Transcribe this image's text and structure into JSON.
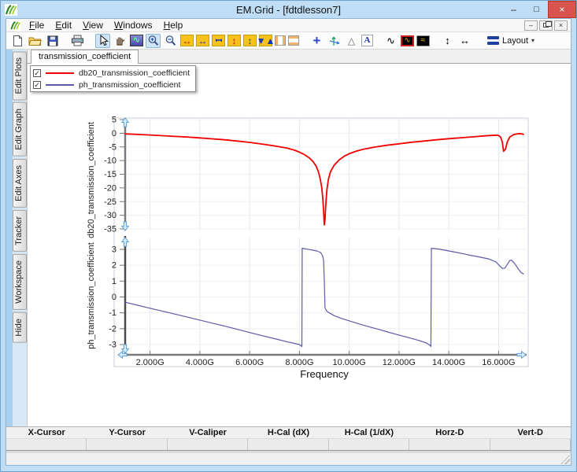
{
  "window": {
    "title": "EM.Grid - [fdtdlesson7]",
    "controls": {
      "minimize": "–",
      "maximize": "□",
      "close": "×"
    }
  },
  "menu": {
    "items": [
      {
        "label": "File",
        "underline": 0
      },
      {
        "label": "Edit",
        "underline": 0
      },
      {
        "label": "View",
        "underline": 0
      },
      {
        "label": "Windows",
        "underline": 0
      },
      {
        "label": "Help",
        "underline": 0
      }
    ],
    "mdi_controls": [
      {
        "name": "mdi-minimize-button",
        "glyph": "–"
      },
      {
        "name": "mdi-restore-button",
        "glyph": "restore-box"
      },
      {
        "name": "mdi-close-button",
        "glyph": "×"
      }
    ]
  },
  "toolbar": {
    "layout_label": "Layout",
    "layout_caret": "▾",
    "items": [
      {
        "name": "new-icon",
        "kind": "svg",
        "icon": "page"
      },
      {
        "name": "open-icon",
        "kind": "svg",
        "icon": "folder"
      },
      {
        "name": "save-icon",
        "kind": "svg",
        "icon": "floppy"
      },
      {
        "kind": "sep"
      },
      {
        "name": "print-icon",
        "kind": "svg",
        "icon": "printer"
      },
      {
        "kind": "sep"
      },
      {
        "name": "select-arrow-icon",
        "kind": "svg",
        "icon": "cursor",
        "selected": true
      },
      {
        "name": "pan-hand-icon",
        "kind": "svg",
        "icon": "hand"
      },
      {
        "name": "plot-mode-icon",
        "kind": "glyph",
        "glyph": "∿",
        "cls": "wavebox"
      },
      {
        "name": "zoom-in-icon",
        "kind": "svg",
        "icon": "zoomin",
        "selected": true
      },
      {
        "name": "zoom-out-icon",
        "kind": "svg",
        "icon": "zoomout"
      },
      {
        "name": "expand-horizontal-icon",
        "kind": "glyph",
        "glyph": "↔",
        "cls": "yellow",
        "fg": "#c01212"
      },
      {
        "name": "shrink-horizontal-icon",
        "kind": "glyph",
        "glyph": "↔",
        "cls": "yellow",
        "fg": "#1536b4"
      },
      {
        "name": "fit-horizontal-icon",
        "kind": "glyph",
        "glyph": "▸▪◂",
        "cls": "yellow tiny",
        "fg": "#1536b4"
      },
      {
        "name": "expand-vertical-icon",
        "kind": "glyph",
        "glyph": "↕",
        "cls": "yellow",
        "fg": "#c01212"
      },
      {
        "name": "shrink-vertical-icon",
        "kind": "glyph",
        "glyph": "↕",
        "cls": "yellow",
        "fg": "#1536b4"
      },
      {
        "name": "fit-vertical-icon",
        "kind": "stack",
        "glyphs": [
          "▼",
          "▲"
        ],
        "cls": "yellow",
        "fg": "#1536b4"
      },
      {
        "name": "left-right-margins-icon",
        "kind": "css",
        "cls": "colv"
      },
      {
        "name": "top-bottom-margins-icon",
        "kind": "css",
        "cls": "colh"
      },
      {
        "kind": "sep"
      },
      {
        "name": "crosshair-icon",
        "kind": "glyph",
        "glyph": "+",
        "cls": "plus",
        "fg": "#2747c8"
      },
      {
        "name": "axes-tracker-icon",
        "kind": "svg",
        "icon": "axes"
      },
      {
        "name": "caliper-triangle-icon",
        "kind": "glyph",
        "glyph": "△",
        "cls": "tri",
        "fg": "#666"
      },
      {
        "name": "text-annotation-icon",
        "kind": "glyph",
        "glyph": "A",
        "cls": "abox",
        "fg": "#232b9e"
      },
      {
        "kind": "sep"
      },
      {
        "name": "copy-plot-icon",
        "kind": "copychart",
        "glyph": "∿"
      },
      {
        "name": "plot-window-icon",
        "kind": "glyph",
        "glyph": "∿",
        "cls": "bw bw-red",
        "fg": "#ff9a20"
      },
      {
        "name": "overlay-plots-icon",
        "kind": "glyph",
        "glyph": "≈",
        "cls": "bw bw-gray",
        "fg": "#ffd020"
      },
      {
        "kind": "sep"
      },
      {
        "name": "distribute-vertical-icon",
        "kind": "dist",
        "glyph": "↕"
      },
      {
        "name": "distribute-horizontal-icon",
        "kind": "dist",
        "glyph": "↔"
      },
      {
        "kind": "sep"
      },
      {
        "name": "layout-button",
        "kind": "layout"
      }
    ]
  },
  "sidebar": {
    "tabs": [
      "Edit Plots",
      "Edit Graph",
      "Edit Axes",
      "Tracker",
      "Workspace",
      "Hide"
    ]
  },
  "tabs": {
    "active": "transmission_coefficient"
  },
  "legend": {
    "items": [
      {
        "label": "db20_transmission_coefficient",
        "color": "#f20000",
        "checked": true,
        "check_glyph": "✓"
      },
      {
        "label": "ph_transmission_coefficient",
        "color": "#5d5aa8",
        "checked": true,
        "check_glyph": "✓"
      }
    ]
  },
  "chart_data": {
    "type": "line",
    "title": "",
    "xlabel": "Frequency",
    "x_unit": "GHz",
    "x_range_ghz": [
      1,
      17
    ],
    "x_tick_values": [
      2,
      4,
      6,
      8,
      10,
      12,
      14,
      16
    ],
    "x_ticks": [
      "2.000G",
      "4.000G",
      "6.000G",
      "8.000G",
      "10.000G",
      "12.000G",
      "14.000G",
      "16.000G"
    ],
    "grid": true,
    "subplots": [
      {
        "ylabel": "db20_transmission_coefficient",
        "ylim": [
          -35,
          5
        ],
        "yticks": [
          5,
          0,
          -5,
          -10,
          -15,
          -20,
          -25,
          -30,
          -35
        ],
        "series": [
          {
            "name": "db20_transmission_coefficient",
            "color": "#f20000",
            "width": 1.8,
            "points": [
              [
                1,
                -0.25
              ],
              [
                1.5,
                -0.45
              ],
              [
                2,
                -0.65
              ],
              [
                2.5,
                -0.9
              ],
              [
                3,
                -1.15
              ],
              [
                3.5,
                -1.4
              ],
              [
                4,
                -1.7
              ],
              [
                4.5,
                -2.05
              ],
              [
                5,
                -2.4
              ],
              [
                5.5,
                -2.85
              ],
              [
                6,
                -3.35
              ],
              [
                6.5,
                -3.95
              ],
              [
                7,
                -4.65
              ],
              [
                7.5,
                -5.45
              ],
              [
                7.8,
                -6.2
              ],
              [
                8,
                -6.9
              ],
              [
                8.2,
                -7.8
              ],
              [
                8.4,
                -9.0
              ],
              [
                8.55,
                -10.4
              ],
              [
                8.67,
                -12
              ],
              [
                8.77,
                -14.3
              ],
              [
                8.84,
                -16.8
              ],
              [
                8.9,
                -20
              ],
              [
                8.94,
                -24
              ],
              [
                8.97,
                -28.5
              ],
              [
                9.0,
                -33.5
              ],
              [
                9.03,
                -31.5
              ],
              [
                9.06,
                -26
              ],
              [
                9.1,
                -21
              ],
              [
                9.16,
                -17
              ],
              [
                9.25,
                -14
              ],
              [
                9.4,
                -11.6
              ],
              [
                9.6,
                -9.7
              ],
              [
                9.8,
                -8.4
              ],
              [
                10,
                -7.5
              ],
              [
                10.3,
                -6.5
              ],
              [
                10.6,
                -5.8
              ],
              [
                11,
                -5.1
              ],
              [
                11.5,
                -4.4
              ],
              [
                12,
                -3.85
              ],
              [
                12.5,
                -3.3
              ],
              [
                13,
                -2.85
              ],
              [
                13.5,
                -2.4
              ],
              [
                14,
                -2.0
              ],
              [
                14.5,
                -1.65
              ],
              [
                15,
                -1.3
              ],
              [
                15.4,
                -1.0
              ],
              [
                15.7,
                -0.8
              ],
              [
                15.95,
                -0.7
              ],
              [
                16.0,
                -0.85
              ],
              [
                16.08,
                -1.4
              ],
              [
                16.15,
                -3.2
              ],
              [
                16.2,
                -6.6
              ],
              [
                16.28,
                -5.8
              ],
              [
                16.35,
                -3.2
              ],
              [
                16.45,
                -1.4
              ],
              [
                16.6,
                -0.5
              ],
              [
                16.75,
                -0.2
              ],
              [
                16.88,
                -0.15
              ],
              [
                17,
                -0.4
              ]
            ]
          }
        ]
      },
      {
        "ylabel": "ph_transmission_coefficient",
        "ylim": [
          -3,
          3
        ],
        "yticks": [
          3,
          2,
          1,
          0,
          -1,
          -2,
          -3
        ],
        "series": [
          {
            "name": "ph_transmission_coefficient",
            "color": "#5d5aa8",
            "width": 1.2,
            "points": [
              [
                1,
                -0.33
              ],
              [
                1.5,
                -0.52
              ],
              [
                2,
                -0.71
              ],
              [
                2.5,
                -0.9
              ],
              [
                3,
                -1.08
              ],
              [
                3.5,
                -1.27
              ],
              [
                4,
                -1.46
              ],
              [
                4.5,
                -1.65
              ],
              [
                5,
                -1.84
              ],
              [
                5.5,
                -2.04
              ],
              [
                6,
                -2.24
              ],
              [
                6.5,
                -2.44
              ],
              [
                7,
                -2.63
              ],
              [
                7.5,
                -2.82
              ],
              [
                8,
                -3.0
              ],
              [
                8.08,
                -3.1
              ],
              [
                8.1,
                -3.13
              ],
              [
                8.11,
                3.07
              ],
              [
                8.4,
                2.99
              ],
              [
                8.7,
                2.9
              ],
              [
                8.85,
                2.8
              ],
              [
                8.93,
                2.6
              ],
              [
                8.97,
                2.3
              ],
              [
                9.0,
                1.0
              ],
              [
                9.03,
                -0.7
              ],
              [
                9.1,
                -0.9
              ],
              [
                9.2,
                -1.0
              ],
              [
                9.4,
                -1.18
              ],
              [
                9.7,
                -1.36
              ],
              [
                10,
                -1.5
              ],
              [
                10.4,
                -1.7
              ],
              [
                10.8,
                -1.88
              ],
              [
                11.2,
                -2.05
              ],
              [
                11.6,
                -2.23
              ],
              [
                12,
                -2.4
              ],
              [
                12.4,
                -2.57
              ],
              [
                12.8,
                -2.74
              ],
              [
                13.1,
                -2.9
              ],
              [
                13.25,
                -3.05
              ],
              [
                13.28,
                -3.12
              ],
              [
                13.3,
                3.07
              ],
              [
                13.6,
                3.02
              ],
              [
                14,
                2.9
              ],
              [
                14.4,
                2.78
              ],
              [
                14.8,
                2.65
              ],
              [
                15.2,
                2.53
              ],
              [
                15.6,
                2.4
              ],
              [
                15.9,
                2.2
              ],
              [
                16.05,
                1.95
              ],
              [
                16.15,
                1.8
              ],
              [
                16.25,
                1.82
              ],
              [
                16.35,
                2.05
              ],
              [
                16.45,
                2.3
              ],
              [
                16.52,
                2.32
              ],
              [
                16.65,
                2.1
              ],
              [
                16.8,
                1.75
              ],
              [
                16.9,
                1.55
              ],
              [
                17,
                1.45
              ]
            ]
          }
        ]
      }
    ]
  },
  "readout": {
    "columns": [
      "X-Cursor",
      "Y-Cursor",
      "V-Caliper",
      "H-Cal (dX)",
      "H-Cal (1/dX)",
      "Horz-D",
      "Vert-D"
    ],
    "values": [
      "",
      "",
      "",
      "",
      "",
      "",
      ""
    ]
  }
}
